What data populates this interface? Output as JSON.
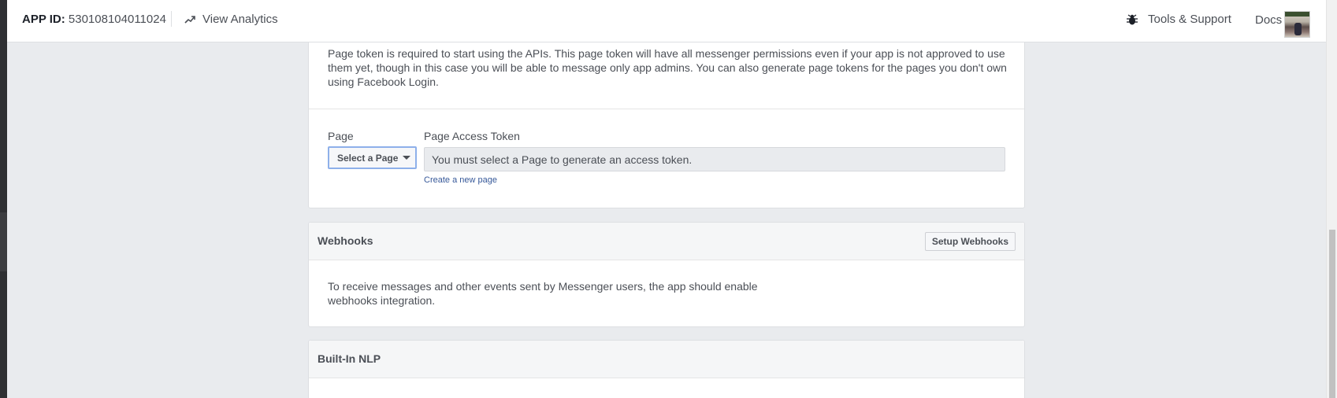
{
  "topbar": {
    "app_id_label": "APP ID:",
    "app_id_value": "530108104011024",
    "analytics_label": "View Analytics",
    "tools_label": "Tools & Support",
    "docs_label": "Docs"
  },
  "page_token_section": {
    "intro": "Page token is required to start using the APIs. This page token will have all messenger permissions even if your app is not approved to use them yet, though in this case you will be able to message only app admins. You can also generate page tokens for the pages you don't own using Facebook Login.",
    "page_label": "Page",
    "select_label": "Select a Page",
    "token_label": "Page Access Token",
    "token_placeholder": "You must select a Page to generate an access token.",
    "create_link": "Create a new page"
  },
  "webhooks_section": {
    "title": "Webhooks",
    "setup_button": "Setup Webhooks",
    "body": "To receive messages and other events sent by Messenger users, the app should enable webhooks integration."
  },
  "nlp_section": {
    "title": "Built-In NLP"
  }
}
